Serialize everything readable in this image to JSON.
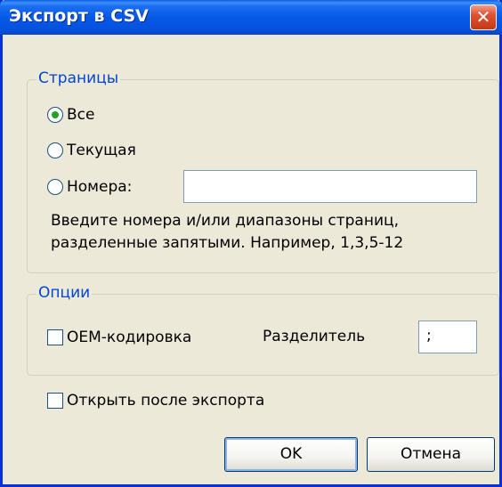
{
  "window": {
    "title": "Экспорт в CSV"
  },
  "pages": {
    "legend": "Страницы",
    "options": [
      {
        "label": "Все",
        "checked": true
      },
      {
        "label": "Текущая",
        "checked": false
      },
      {
        "label": "Номера:",
        "checked": false
      }
    ],
    "range_value": "",
    "help_line1": "Введите номера и/или диапазоны страниц,",
    "help_line2": "разделенные запятыми. Например, 1,3,5-12"
  },
  "options": {
    "legend": "Опции",
    "oem_label": "OEM-кодировка",
    "oem_checked": false,
    "separator_label": "Разделитель",
    "separator_value": ";"
  },
  "open_after_label": "Открыть после экспорта",
  "open_after_checked": false,
  "buttons": {
    "ok": "OK",
    "cancel": "Отмена"
  }
}
